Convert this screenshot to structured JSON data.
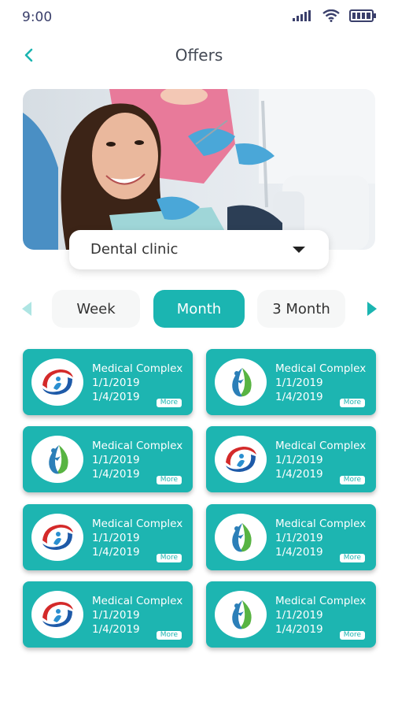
{
  "status": {
    "time": "9:00"
  },
  "header": {
    "title": "Offers"
  },
  "dropdown": {
    "selected": "Dental clinic"
  },
  "tabs": [
    {
      "label": "Week",
      "active": false
    },
    {
      "label": "Month",
      "active": true
    },
    {
      "label": "3 Month",
      "active": false
    }
  ],
  "offers": [
    {
      "name": "Medical Complex",
      "start": "1/1/2019",
      "end": "1/4/2019",
      "more": "More",
      "logo": "red-blue-swirl-logo"
    },
    {
      "name": "Medical Complex",
      "start": "1/1/2019",
      "end": "1/4/2019",
      "more": "More",
      "logo": "green-leaf-person-logo"
    },
    {
      "name": "Medical Complex",
      "start": "1/1/2019",
      "end": "1/4/2019",
      "more": "More",
      "logo": "green-leaf-person-logo"
    },
    {
      "name": "Medical Complex",
      "start": "1/1/2019",
      "end": "1/4/2019",
      "more": "More",
      "logo": "red-blue-swirl-logo"
    },
    {
      "name": "Medical Complex",
      "start": "1/1/2019",
      "end": "1/4/2019",
      "more": "More",
      "logo": "red-blue-swirl-logo"
    },
    {
      "name": "Medical Complex",
      "start": "1/1/2019",
      "end": "1/4/2019",
      "more": "More",
      "logo": "green-leaf-person-logo"
    },
    {
      "name": "Medical Complex",
      "start": "1/1/2019",
      "end": "1/4/2019",
      "more": "More",
      "logo": "red-blue-swirl-logo"
    },
    {
      "name": "Medical Complex",
      "start": "1/1/2019",
      "end": "1/4/2019",
      "more": "More",
      "logo": "green-leaf-person-logo"
    }
  ],
  "colors": {
    "accent": "#1bb5b1",
    "status_icons": "#3a3f6b"
  }
}
